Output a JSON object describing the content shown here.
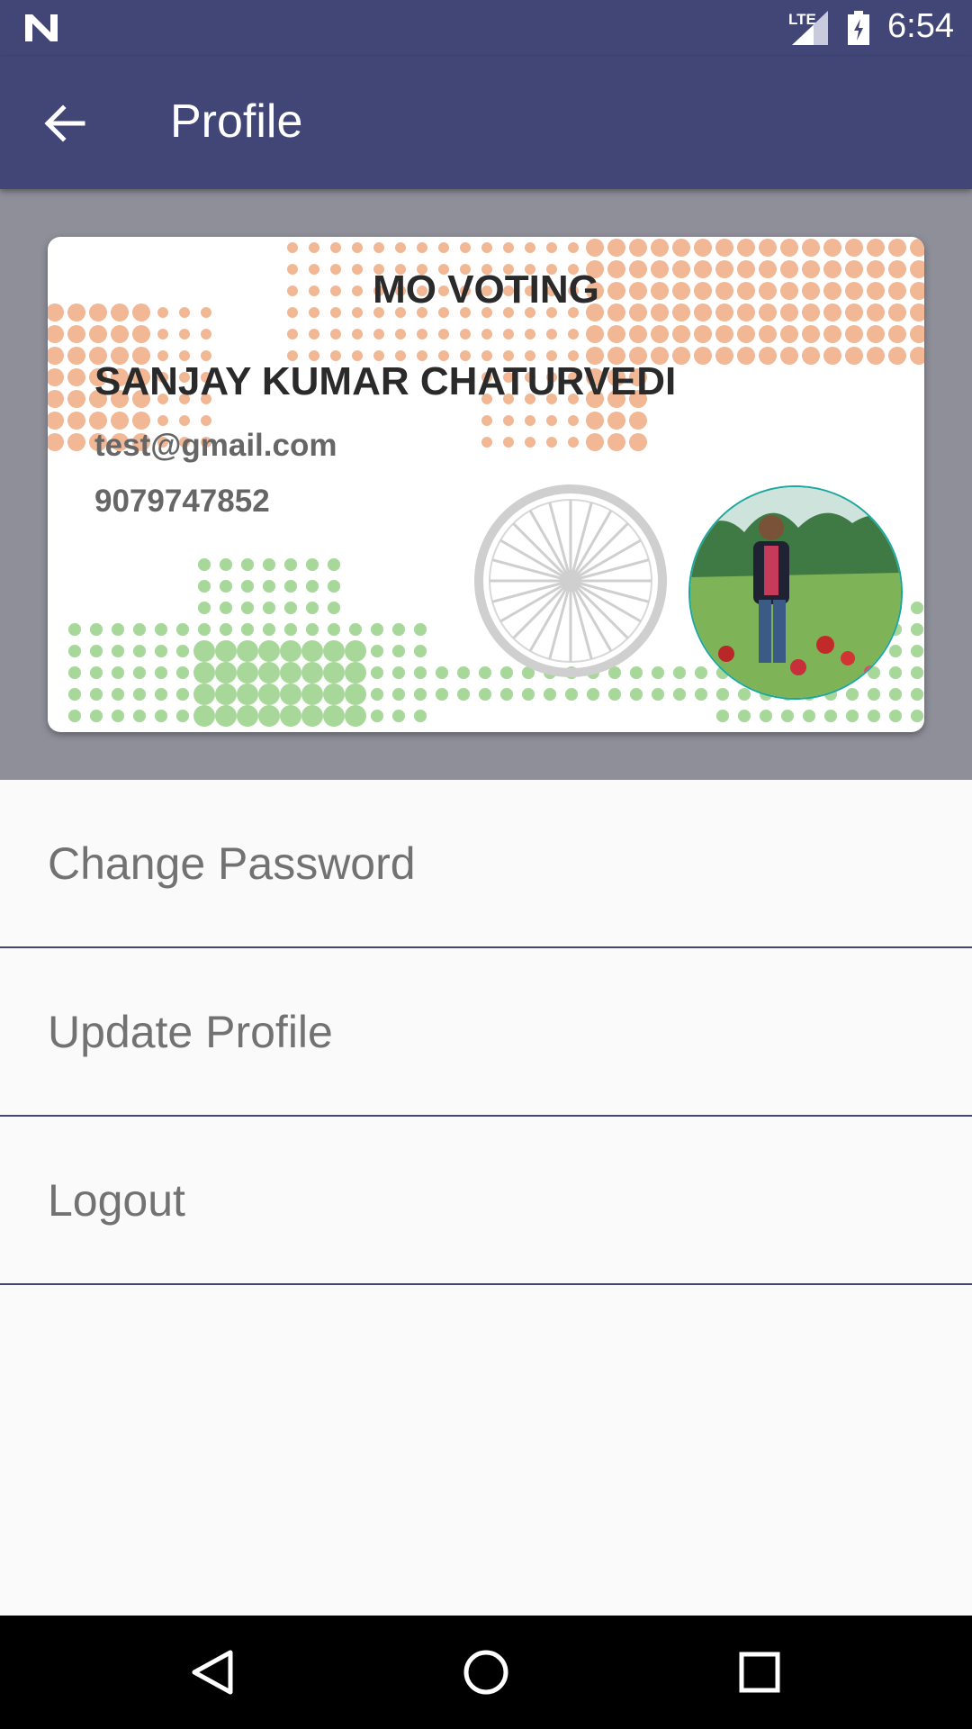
{
  "status_bar": {
    "network_label": "LTE",
    "time": "6:54",
    "icons": [
      "n-logo-icon",
      "lte-signal-icon",
      "battery-icon"
    ]
  },
  "app_bar": {
    "title": "Profile",
    "back_icon": "arrow-back-icon"
  },
  "profile_card": {
    "title": "MO VOTING",
    "name": "SANJAY KUMAR CHATURVEDI",
    "email": "test@gmail.com",
    "phone": "9079747852",
    "emblem_icon": "ashoka-chakra-icon",
    "avatar": "profile-photo"
  },
  "menu": {
    "items": [
      {
        "label": "Change Password"
      },
      {
        "label": "Update Profile"
      },
      {
        "label": "Logout"
      }
    ]
  },
  "nav_bar": {
    "icons": [
      "back-triangle-icon",
      "home-circle-icon",
      "recents-square-icon"
    ]
  },
  "colors": {
    "primary": "#414676",
    "header_band": "#8e8f99",
    "background": "#fafafa",
    "menu_text": "#727272",
    "saffron": "#f2b896",
    "green": "#a8d79a"
  }
}
